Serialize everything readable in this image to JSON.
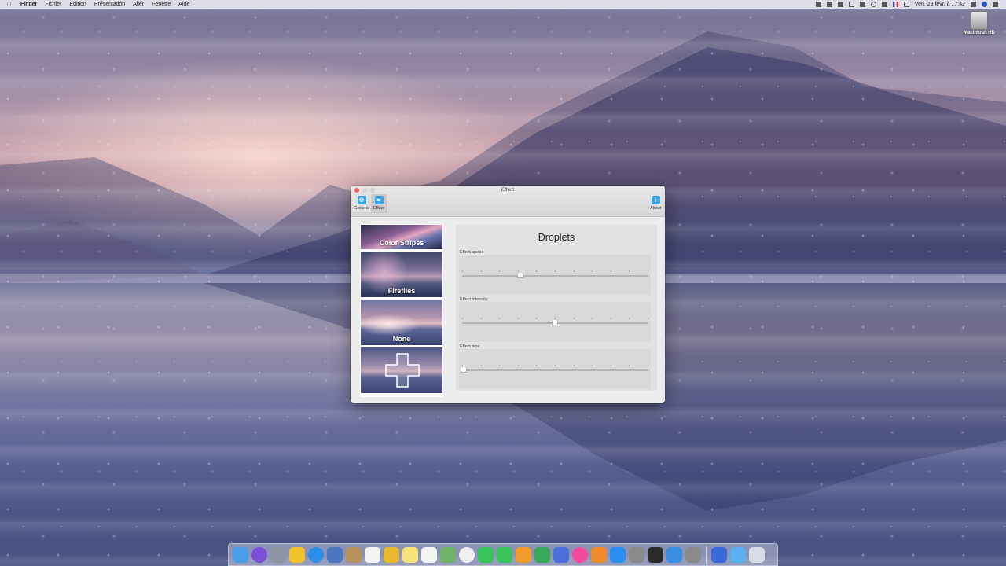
{
  "menubar": {
    "items": [
      "Finder",
      "Fichier",
      "Édition",
      "Présentation",
      "Aller",
      "Fenêtre",
      "Aide"
    ],
    "clock": "Ven. 23 févr. à 17:42"
  },
  "desktop": {
    "disk_label": "Macintosh HD"
  },
  "window": {
    "title": "Effect",
    "toolbar": {
      "general": "General",
      "effect": "Effect",
      "about": "About"
    },
    "effects": [
      {
        "name": "Color Stripes"
      },
      {
        "name": "Fireflies"
      },
      {
        "name": "None"
      },
      {
        "name": ""
      }
    ],
    "panel": {
      "title": "Droplets",
      "sliders": [
        {
          "label": "Effect speed",
          "value": 0.31
        },
        {
          "label": "Effect intensity",
          "value": 0.5
        },
        {
          "label": "Effect size",
          "value": 0.0
        }
      ]
    }
  },
  "dock": {
    "icons": [
      "finder-icon",
      "siri-icon",
      "launchpad-icon",
      "cyberduck-icon",
      "safari-icon",
      "preview-icon",
      "notes-folder-icon",
      "calendar-icon",
      "wallpaper-app-icon",
      "notes-icon",
      "reminders-icon",
      "maps-icon",
      "photos-icon",
      "messages-icon",
      "facetime-icon",
      "pages-icon",
      "numbers-icon",
      "keynote-icon",
      "itunes-icon",
      "books-icon",
      "app-store-icon",
      "system-preferences-icon",
      "terminal-icon",
      "xcode-icon",
      "utility-icon",
      "window-icon",
      "downloads-folder-icon",
      "trash-icon"
    ],
    "colors": [
      "#4a9ee8",
      "#7b4fd8",
      "#8e96a6",
      "#f2c12e",
      "#2a8ee8",
      "#4c76c0",
      "#b8925c",
      "#f4f4f4",
      "#e8b830",
      "#f7e27a",
      "#f2f2f2",
      "#6fb36a",
      "#f0f0f0",
      "#3ac35a",
      "#3ac35a",
      "#f09a2c",
      "#37a85a",
      "#4a6fd8",
      "#f24a9c",
      "#f08a2a",
      "#2a8ef0",
      "#8a8a8a",
      "#2a2a2a",
      "#3a8ee0",
      "#8a8a8a",
      "#3a6ad8",
      "#5ab0f0",
      "#d8dde4"
    ]
  }
}
